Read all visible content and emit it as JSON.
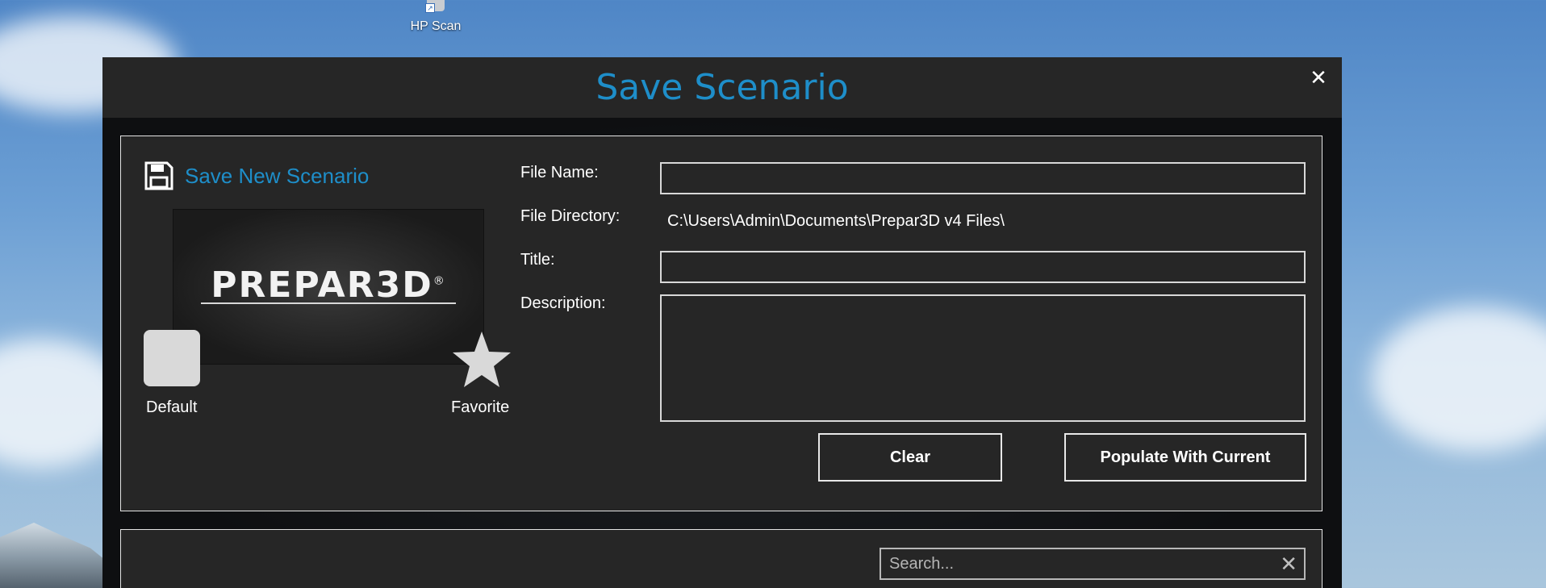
{
  "desktop": {
    "icon_label": "HP Scan"
  },
  "window": {
    "title": "Save Scenario",
    "close_glyph": "✕"
  },
  "save_panel": {
    "heading": "Save New Scenario",
    "thumbnail_logo": "PREPAR3D",
    "thumbnail_logo_mark": "®",
    "default_label": "Default",
    "favorite_label": "Favorite",
    "fields": {
      "file_name_label": "File Name:",
      "file_name_value": "",
      "file_directory_label": "File Directory:",
      "file_directory_value": "C:\\Users\\Admin\\Documents\\Prepar3D v4 Files\\",
      "title_label": "Title:",
      "title_value": "",
      "description_label": "Description:",
      "description_value": ""
    },
    "buttons": {
      "clear": "Clear",
      "populate": "Populate With Current"
    }
  },
  "list_panel": {
    "search_placeholder": "Search...",
    "search_clear_glyph": "✕"
  },
  "colors": {
    "accent": "#1e8ec9",
    "panel_bg": "#262626",
    "border": "#e4e4e4"
  }
}
